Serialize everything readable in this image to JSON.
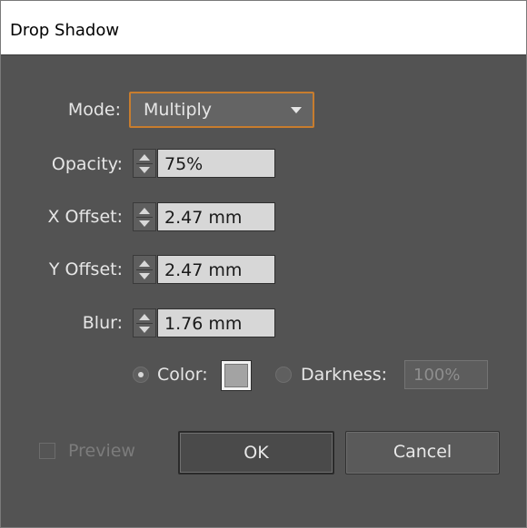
{
  "window": {
    "title": "Drop Shadow"
  },
  "mode": {
    "label": "Mode:",
    "value": "Multiply"
  },
  "opacity": {
    "label": "Opacity:",
    "value": "75%"
  },
  "x_offset": {
    "label": "X Offset:",
    "value": "2.47 mm"
  },
  "y_offset": {
    "label": "Y Offset:",
    "value": "2.47 mm"
  },
  "blur": {
    "label": "Blur:",
    "value": "1.76 mm"
  },
  "color_option": {
    "label": "Color:",
    "selected": true,
    "swatch": "#a3a3a3"
  },
  "darkness_option": {
    "label": "Darkness:",
    "value": "100%",
    "selected": false
  },
  "preview": {
    "label": "Preview",
    "checked": false
  },
  "buttons": {
    "ok": "OK",
    "cancel": "Cancel"
  },
  "colors": {
    "panel_bg": "#535353",
    "focus_accent": "#c87d2e"
  }
}
